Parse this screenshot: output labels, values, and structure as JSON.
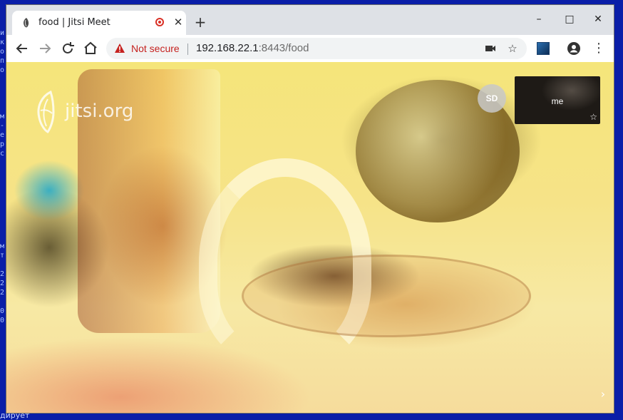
{
  "desktop": {
    "side_glyphs": [
      "и",
      "к",
      "о",
      "п",
      "о",
      "",
      "",
      "",
      "",
      "м",
      "-",
      "е",
      "р",
      "с",
      "",
      "",
      "",
      "",
      "",
      "",
      "",
      "",
      "",
      "м",
      "т",
      "",
      "2",
      "2",
      "2",
      "",
      "0",
      "0"
    ],
    "bottom_text": "дирует"
  },
  "browser": {
    "tab": {
      "title": "food | Jitsi Meet",
      "recording": true
    },
    "window_controls": {
      "minimize": "–",
      "maximize": "□",
      "close": "✕"
    },
    "toolbar": {
      "security_label": "Not secure",
      "url_host": "192.168.22.1",
      "url_rest": ":8443/food"
    }
  },
  "meeting": {
    "watermark": "jitsi.org",
    "remote_avatar_initials": "SD",
    "local_thumbnail_label": "me",
    "colors": {
      "accent_red": "#d93025"
    }
  }
}
